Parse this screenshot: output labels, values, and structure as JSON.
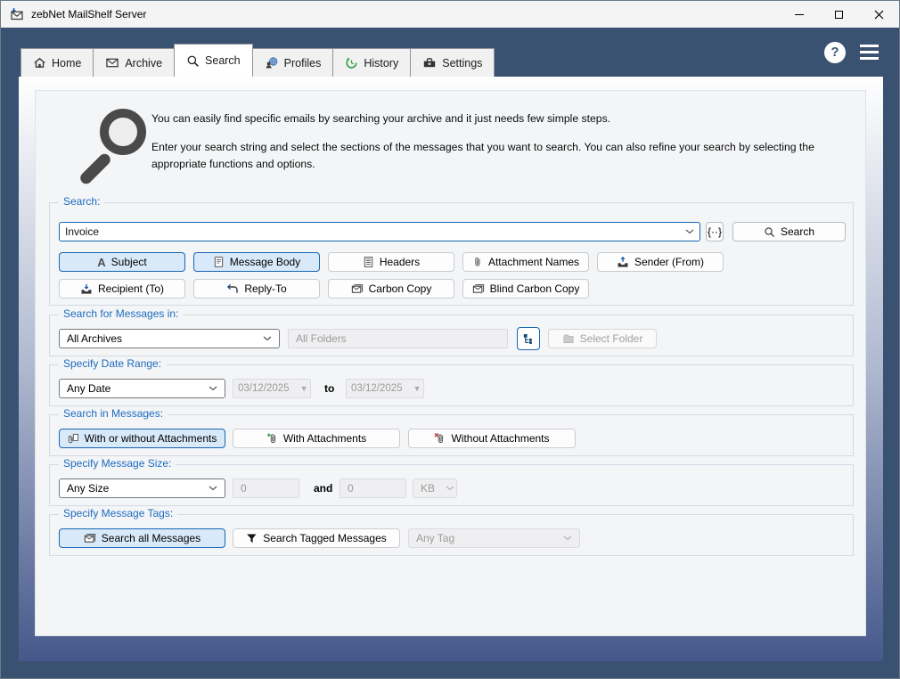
{
  "window": {
    "title": "zebNet MailShelf Server"
  },
  "titlebar": {
    "app_icon": "envelope-with-blue-arrow-icon",
    "controls": [
      {
        "name": "minimize",
        "icon": "minimize-icon"
      },
      {
        "name": "maximize",
        "icon": "maximize-icon"
      },
      {
        "name": "close",
        "icon": "close-icon"
      }
    ]
  },
  "header": {
    "help_glyph": "?",
    "help_icon": "help-circle-icon",
    "menu_icon": "hamburger-menu-icon"
  },
  "tabs": [
    {
      "label": "Home",
      "icon": "home-icon",
      "active": false
    },
    {
      "label": "Archive",
      "icon": "envelope-icon",
      "active": false
    },
    {
      "label": "Search",
      "icon": "magnifier-icon",
      "active": true
    },
    {
      "label": "Profiles",
      "icon": "person-globe-icon",
      "active": false
    },
    {
      "label": "History",
      "icon": "history-clock-icon",
      "active": false
    },
    {
      "label": "Settings",
      "icon": "toolbox-icon",
      "active": false
    }
  ],
  "intro": {
    "icon": "large-magnifier-icon",
    "paragraph1": "You can easily find specific emails by searching your archive and it just needs few simple steps.",
    "paragraph2": "Enter your search string and select the sections of the messages that you want to search. You can also refine your search by selecting the appropriate functions and options."
  },
  "search": {
    "label": "Search:",
    "query": "Invoice",
    "regex_button": "{··}",
    "button": "Search",
    "button_icon": "magnifier-icon",
    "sections": [
      {
        "label": "Subject",
        "icon": "letter-a-icon",
        "selected": true
      },
      {
        "label": "Message Body",
        "icon": "document-icon",
        "selected": true
      },
      {
        "label": "Headers",
        "icon": "document-lines-icon",
        "selected": false
      },
      {
        "label": "Attachment Names",
        "icon": "paperclip-icon",
        "selected": false
      },
      {
        "label": "Sender (From)",
        "icon": "outbox-arrow-icon",
        "selected": false
      },
      {
        "label": "Recipient (To)",
        "icon": "inbox-arrow-icon",
        "selected": false
      },
      {
        "label": "Reply-To",
        "icon": "reply-arrow-icon",
        "selected": false
      },
      {
        "label": "Carbon Copy",
        "icon": "envelope-copy-icon",
        "selected": false
      },
      {
        "label": "Blind Carbon Copy",
        "icon": "envelope-copy-icon",
        "selected": false
      }
    ]
  },
  "scope": {
    "label": "Search for Messages in:",
    "archive": "All Archives",
    "folders": "All Folders",
    "tree_button_icon": "folder-tree-icon",
    "select_folder": "Select Folder",
    "select_folder_icon": "folder-icon"
  },
  "date_range": {
    "label": "Specify Date Range:",
    "preset": "Any Date",
    "from": "03/12/2025",
    "to_word": "to",
    "to": "03/12/2025",
    "calendar_icon": "calendar-icon"
  },
  "attachments": {
    "label": "Search in Messages:",
    "options": [
      {
        "label": "With or without Attachments",
        "icon": "paperclip-document-icon",
        "selected": true
      },
      {
        "label": "With Attachments",
        "icon": "paperclip-plus-icon",
        "selected": false
      },
      {
        "label": "Without Attachments",
        "icon": "paperclip-x-icon",
        "selected": false
      }
    ]
  },
  "size": {
    "label": "Specify Message Size:",
    "preset": "Any Size",
    "min": "0",
    "and_word": "and",
    "max": "0",
    "unit": "KB"
  },
  "tags": {
    "label": "Specify Message Tags:",
    "options": [
      {
        "label": "Search all Messages",
        "icon": "envelope-copy-icon",
        "selected": true
      },
      {
        "label": "Search Tagged Messages",
        "icon": "filter-funnel-icon",
        "selected": false
      }
    ],
    "tag": "Any Tag"
  }
}
